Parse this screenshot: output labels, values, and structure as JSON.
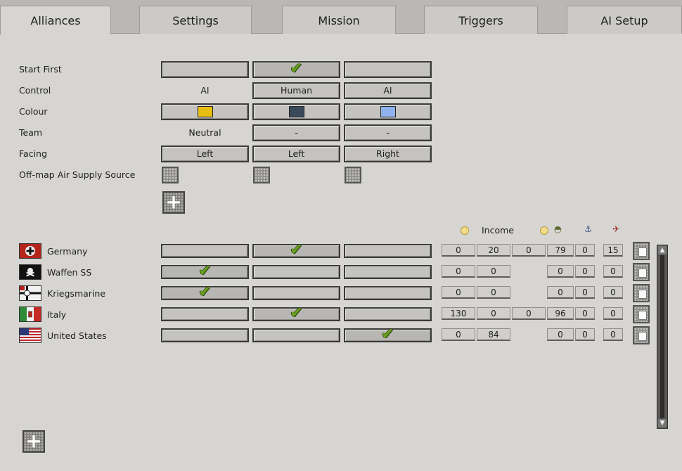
{
  "tabs": [
    {
      "label": "Alliances",
      "active": true
    },
    {
      "label": "Settings",
      "active": false
    },
    {
      "label": "Mission",
      "active": false
    },
    {
      "label": "Triggers",
      "active": false
    },
    {
      "label": "AI Setup",
      "active": false
    }
  ],
  "alliance_settings": {
    "start_first_label": "Start First",
    "control_label": "Control",
    "colour_label": "Colour",
    "team_label": "Team",
    "facing_label": "Facing",
    "air_supply_label": "Off-map Air Supply Source",
    "start_first": [
      false,
      true,
      false
    ],
    "control": [
      "AI",
      "Human",
      "AI"
    ],
    "colour": [
      "#e8bd12",
      "#3b4a5a",
      "#8fb2ee"
    ],
    "team": [
      "Neutral",
      "-",
      "-"
    ],
    "facing": [
      "Left",
      "Left",
      "Right"
    ]
  },
  "resource_header": {
    "income_label": "Income",
    "icons": [
      "prestige-coin-icon",
      "income-coin-icon",
      "helmet-icon",
      "anchor-icon",
      "plane-icon"
    ]
  },
  "nations": [
    {
      "name": "Germany",
      "flag": "germany-flag-icon",
      "alliance": 1,
      "values": [
        "0",
        "20",
        "0",
        "79",
        "0",
        "15"
      ]
    },
    {
      "name": "Waffen SS",
      "flag": "waffen-ss-flag-icon",
      "alliance": 0,
      "values": [
        "0",
        "0",
        "",
        "0",
        "0",
        "0"
      ]
    },
    {
      "name": "Kriegsmarine",
      "flag": "kriegsmarine-flag-icon",
      "alliance": 0,
      "values": [
        "0",
        "0",
        "",
        "0",
        "0",
        "0"
      ]
    },
    {
      "name": "Italy",
      "flag": "italy-flag-icon",
      "alliance": 1,
      "values": [
        "130",
        "0",
        "0",
        "96",
        "0",
        "0"
      ]
    },
    {
      "name": "United States",
      "flag": "usa-flag-icon",
      "alliance": 2,
      "values": [
        "0",
        "84",
        "",
        "0",
        "0",
        "0"
      ]
    }
  ],
  "colors": {
    "check": "#6aa021",
    "background": "#d6d5d2"
  }
}
